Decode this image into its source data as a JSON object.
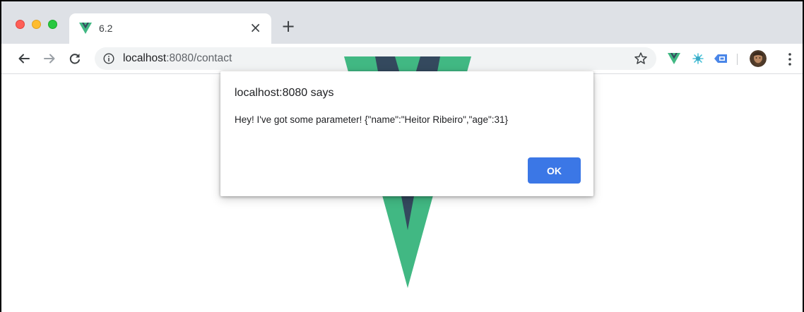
{
  "browser": {
    "tab": {
      "title": "6.2",
      "close_glyph": "×"
    },
    "new_tab_glyph": "+",
    "address": {
      "host": "localhost",
      "rest": ":8080/contact"
    }
  },
  "dialog": {
    "title": "localhost:8080 says",
    "message": "Hey! I've got some parameter! {\"name\":\"Heitor Ribeiro\",\"age\":31}",
    "ok_label": "OK"
  },
  "colors": {
    "vue_green": "#41b883",
    "vue_dark": "#34495e",
    "ok_button": "#3b77e6",
    "tabstrip": "#dee1e6"
  },
  "icons": {
    "tab_favicon": "vue-logo-icon",
    "back": "arrow-left-icon",
    "forward": "arrow-right-icon",
    "reload": "reload-icon",
    "site_info": "info-icon",
    "bookmark": "star-icon",
    "ext1": "vue-devtools-icon",
    "ext2": "gear-ext-icon",
    "ext3": "keyboard-ext-icon",
    "profile": "avatar-icon",
    "menu": "kebab-menu-icon"
  }
}
